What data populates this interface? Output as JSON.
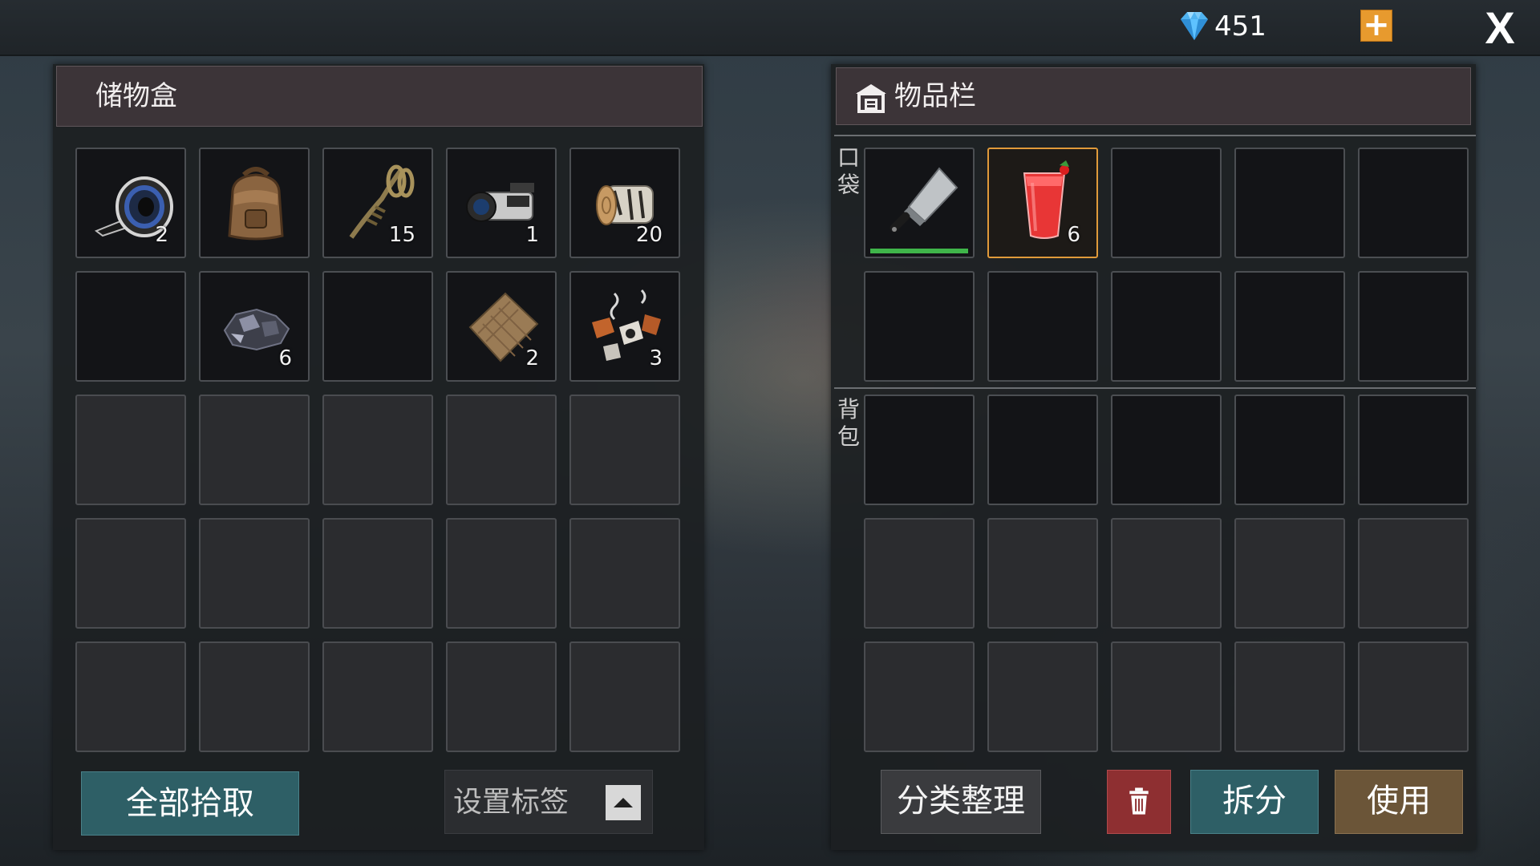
{
  "topbar": {
    "gem_icon": "diamond-icon",
    "gem_count": "451",
    "add_icon": "plus-icon",
    "close_label": "X"
  },
  "storage": {
    "title": "储物盒",
    "slots": [
      {
        "item": "tape-roll-icon",
        "count": "2"
      },
      {
        "item": "backpack-icon",
        "count": ""
      },
      {
        "item": "rope-icon",
        "count": "15"
      },
      {
        "item": "video-camera-icon",
        "count": "1"
      },
      {
        "item": "log-icon",
        "count": "20"
      },
      {
        "item": "",
        "count": ""
      },
      {
        "item": "coal-ore-icon",
        "count": "6"
      },
      {
        "item": "",
        "count": ""
      },
      {
        "item": "burlap-cloth-icon",
        "count": "2"
      },
      {
        "item": "scrap-parts-icon",
        "count": "3"
      }
    ],
    "loot_all_label": "全部拾取",
    "set_tag_label": "设置标签"
  },
  "inventory": {
    "title": "物品栏",
    "header_icon": "house-icon",
    "pocket_label": [
      "口",
      "袋"
    ],
    "backpack_label": [
      "背",
      "包"
    ],
    "pocket_slots": [
      {
        "item": "cleaver-icon",
        "count": "",
        "durability": 1.0
      },
      {
        "item": "tomato-juice-icon",
        "count": "6",
        "selected": true
      }
    ],
    "sort_label": "分类整理",
    "delete_icon": "trash-icon",
    "split_label": "拆分",
    "use_label": "使用"
  },
  "colors": {
    "accent_orange": "#e79a2e",
    "teal_button": "#2e5f66",
    "delete_red": "#8e2f31",
    "use_brown": "#6b5538",
    "durability_green": "#3fb54a"
  }
}
